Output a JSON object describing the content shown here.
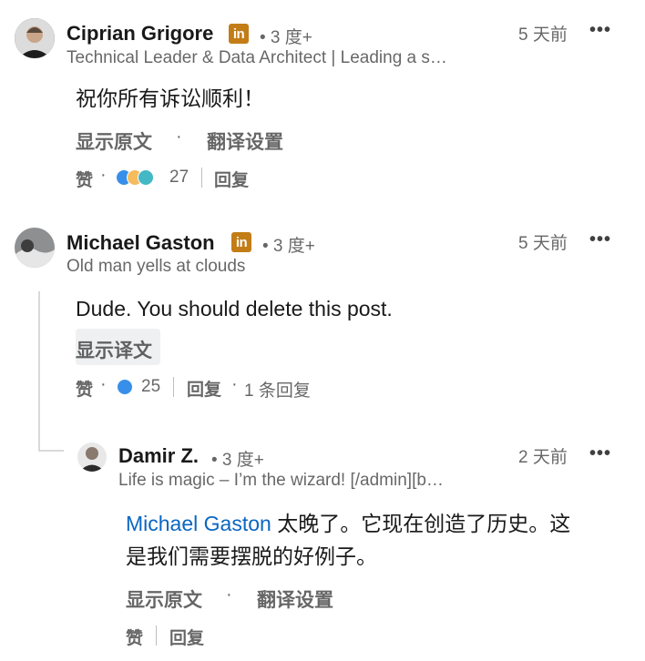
{
  "comments": [
    {
      "author": "Ciprian Grigore",
      "degree": "• 3 度+",
      "headline": "Technical Leader & Data Architect | Leading a s…",
      "time": "5 天前",
      "more": "•••",
      "text": "祝你所有诉讼顺利！",
      "show_original": "显示原文",
      "translation_settings": "翻译设置",
      "like": "赞",
      "reaction_count": "27",
      "reply": "回复"
    },
    {
      "author": "Michael Gaston",
      "degree": "• 3 度+",
      "headline": "Old man yells at clouds",
      "time": "5 天前",
      "more": "•••",
      "text": "Dude. You should delete this post.",
      "show_translation": "显示译文",
      "like": "赞",
      "reaction_count": "25",
      "reply": "回复",
      "reply_count": "1 条回复"
    }
  ],
  "reply": {
    "author": "Damir Z.",
    "degree": "• 3 度+",
    "headline": "Life is magic – I’m the wizard! [/admin][b…",
    "time": "2 天前",
    "more": "•••",
    "mention": "Michael Gaston",
    "text_line1": " 太晚了。它现在创造了历史。这",
    "text_line2": "是我们需要摆脱的好例子。",
    "show_original": "显示原文",
    "translation_settings": "翻译设置",
    "like": "赞",
    "reply": "回复"
  },
  "common": {
    "linkedin_badge": "in",
    "dot_sep": "·"
  },
  "colors": {
    "linkedin_badge": "#c37d16",
    "mention": "#0a66c2",
    "thread_line": "#d9d9d9"
  }
}
